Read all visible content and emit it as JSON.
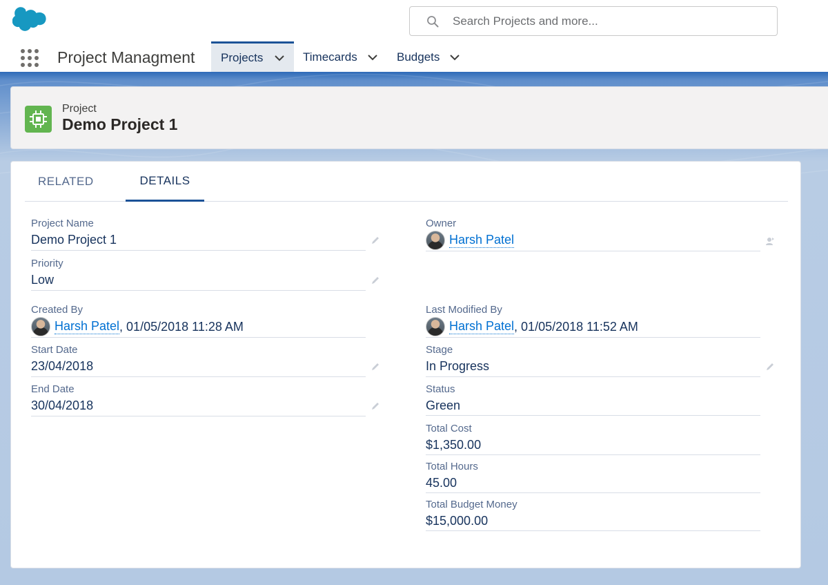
{
  "header": {
    "search_placeholder": "Search Projects and more...",
    "app_name": "Project Managment",
    "nav": [
      {
        "label": "Projects",
        "active": true
      },
      {
        "label": "Timecards",
        "active": false
      },
      {
        "label": "Budgets",
        "active": false
      }
    ]
  },
  "record": {
    "type_label": "Project",
    "title": "Demo Project 1"
  },
  "tabs": [
    {
      "label": "RELATED",
      "active": false
    },
    {
      "label": "DETAILS",
      "active": true
    }
  ],
  "fields": {
    "project_name": {
      "label": "Project Name",
      "value": "Demo Project 1"
    },
    "owner": {
      "label": "Owner",
      "user": "Harsh Patel"
    },
    "priority": {
      "label": "Priority",
      "value": "Low"
    },
    "created_by": {
      "label": "Created By",
      "user": "Harsh Patel",
      "timestamp": ", 01/05/2018 11:28 AM"
    },
    "last_modified_by": {
      "label": "Last Modified By",
      "user": "Harsh Patel",
      "timestamp": ", 01/05/2018 11:52 AM"
    },
    "start_date": {
      "label": "Start Date",
      "value": "23/04/2018"
    },
    "stage": {
      "label": "Stage",
      "value": "In Progress"
    },
    "end_date": {
      "label": "End Date",
      "value": "30/04/2018"
    },
    "status": {
      "label": "Status",
      "value": "Green"
    },
    "total_cost": {
      "label": "Total Cost",
      "value": "$1,350.00"
    },
    "total_hours": {
      "label": "Total Hours",
      "value": "45.00"
    },
    "total_budget_money": {
      "label": "Total Budget Money",
      "value": "$15,000.00"
    }
  },
  "colors": {
    "brand_blue": "#1b5297",
    "link_blue": "#0070d2",
    "record_icon_green": "#62b550",
    "salesforce_cloud": "#1798c1"
  }
}
